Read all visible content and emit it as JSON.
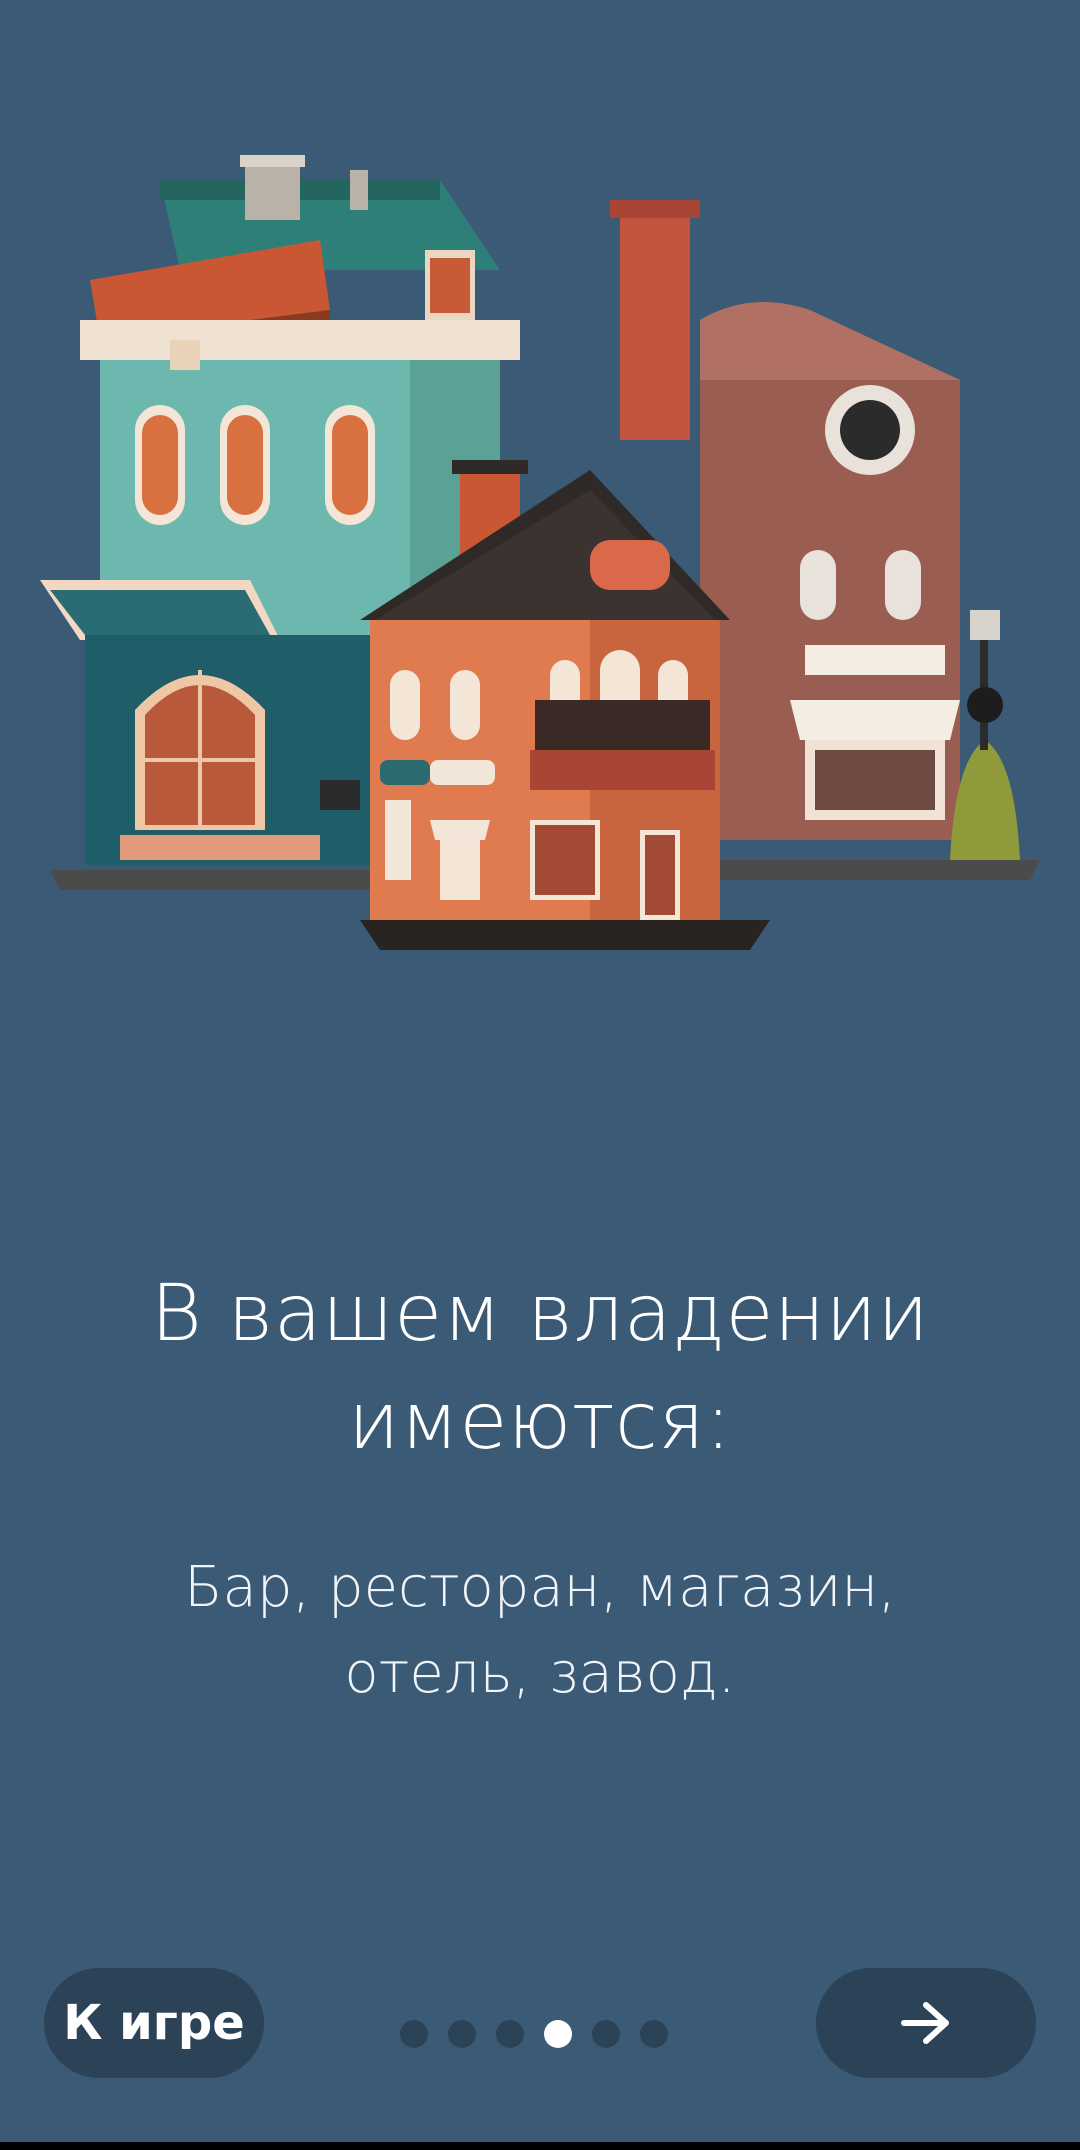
{
  "onboarding": {
    "title_line1": "В вашем владении",
    "title_line2": "имеются:",
    "subtitle_line1": "Бар, ресторан, магазин,",
    "subtitle_line2": "отель, завод.",
    "total_pages": 6,
    "current_page": 4
  },
  "nav": {
    "skip_label": "К игре",
    "next_icon": "arrow-right-icon"
  },
  "illustration": {
    "subject": "city-buildings-illustration"
  },
  "colors": {
    "background": "#3b5a75",
    "button_bg": "#2c4257",
    "dot_inactive": "#2c4257",
    "dot_active": "#ffffff"
  }
}
